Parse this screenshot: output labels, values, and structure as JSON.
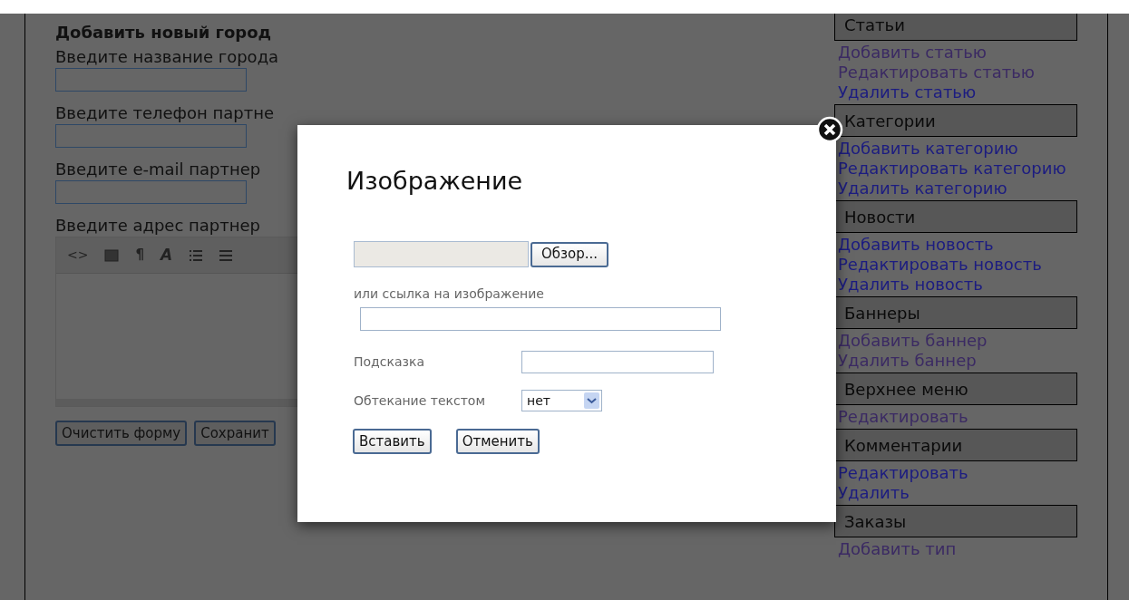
{
  "form": {
    "title": "Добавить новый город",
    "fields": [
      {
        "label": "Введите название города"
      },
      {
        "label": "Введите телефон партне"
      },
      {
        "label": "Введите e-mail партнер"
      }
    ],
    "address_label": "Введите адрес партнер",
    "editor_toolbar": {
      "code_label": "<>",
      "pilcrow": "¶",
      "font_label": "A"
    },
    "buttons": [
      "Очистить форму",
      "Сохранит"
    ]
  },
  "sidebar": {
    "sections": [
      {
        "title": "Статьи",
        "links": [
          {
            "text": "Добавить статью",
            "visited": true
          },
          {
            "text": "Редактировать статью",
            "visited": true
          },
          {
            "text": "Удалить статью",
            "visited": false
          }
        ]
      },
      {
        "title": "Категории",
        "links": [
          {
            "text": "Добавить категорию",
            "visited": false
          },
          {
            "text": "Редактировать категорию",
            "visited": false
          },
          {
            "text": "Удалить категорию",
            "visited": false
          }
        ]
      },
      {
        "title": "Новости",
        "links": [
          {
            "text": "Добавить новость",
            "visited": false
          },
          {
            "text": "Редактировать новость",
            "visited": false
          },
          {
            "text": "Удалить новость",
            "visited": false
          }
        ]
      },
      {
        "title": "Баннеры",
        "links": [
          {
            "text": "Добавить баннер",
            "visited": true
          },
          {
            "text": "Удалить баннер",
            "visited": true
          }
        ]
      },
      {
        "title": "Верхнее меню",
        "links": [
          {
            "text": "Редактировать",
            "visited": true
          }
        ]
      },
      {
        "title": "Комментарии",
        "links": [
          {
            "text": "Редактировать",
            "visited": false
          },
          {
            "text": "Удалить",
            "visited": false
          }
        ]
      },
      {
        "title": "Заказы",
        "links": [
          {
            "text": "Добавить тип",
            "visited": true
          }
        ]
      }
    ]
  },
  "modal": {
    "title": "Изображение",
    "browse_button": "Обзор...",
    "link_label": "или ссылка на изображение",
    "hint_label": "Подсказка",
    "wrap_label": "Обтекание текстом",
    "wrap_value": "нет",
    "buttons": [
      "Вставить",
      "Отменить"
    ]
  }
}
